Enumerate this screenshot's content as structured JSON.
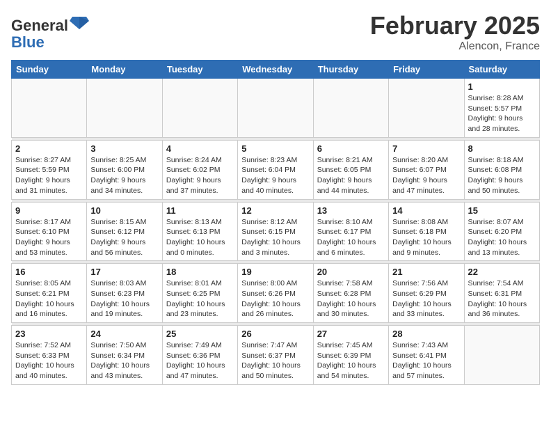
{
  "header": {
    "logo_general": "General",
    "logo_blue": "Blue",
    "month_title": "February 2025",
    "location": "Alencon, France"
  },
  "weekdays": [
    "Sunday",
    "Monday",
    "Tuesday",
    "Wednesday",
    "Thursday",
    "Friday",
    "Saturday"
  ],
  "weeks": [
    [
      {
        "day": "",
        "info": ""
      },
      {
        "day": "",
        "info": ""
      },
      {
        "day": "",
        "info": ""
      },
      {
        "day": "",
        "info": ""
      },
      {
        "day": "",
        "info": ""
      },
      {
        "day": "",
        "info": ""
      },
      {
        "day": "1",
        "info": "Sunrise: 8:28 AM\nSunset: 5:57 PM\nDaylight: 9 hours and 28 minutes."
      }
    ],
    [
      {
        "day": "2",
        "info": "Sunrise: 8:27 AM\nSunset: 5:59 PM\nDaylight: 9 hours and 31 minutes."
      },
      {
        "day": "3",
        "info": "Sunrise: 8:25 AM\nSunset: 6:00 PM\nDaylight: 9 hours and 34 minutes."
      },
      {
        "day": "4",
        "info": "Sunrise: 8:24 AM\nSunset: 6:02 PM\nDaylight: 9 hours and 37 minutes."
      },
      {
        "day": "5",
        "info": "Sunrise: 8:23 AM\nSunset: 6:04 PM\nDaylight: 9 hours and 40 minutes."
      },
      {
        "day": "6",
        "info": "Sunrise: 8:21 AM\nSunset: 6:05 PM\nDaylight: 9 hours and 44 minutes."
      },
      {
        "day": "7",
        "info": "Sunrise: 8:20 AM\nSunset: 6:07 PM\nDaylight: 9 hours and 47 minutes."
      },
      {
        "day": "8",
        "info": "Sunrise: 8:18 AM\nSunset: 6:08 PM\nDaylight: 9 hours and 50 minutes."
      }
    ],
    [
      {
        "day": "9",
        "info": "Sunrise: 8:17 AM\nSunset: 6:10 PM\nDaylight: 9 hours and 53 minutes."
      },
      {
        "day": "10",
        "info": "Sunrise: 8:15 AM\nSunset: 6:12 PM\nDaylight: 9 hours and 56 minutes."
      },
      {
        "day": "11",
        "info": "Sunrise: 8:13 AM\nSunset: 6:13 PM\nDaylight: 10 hours and 0 minutes."
      },
      {
        "day": "12",
        "info": "Sunrise: 8:12 AM\nSunset: 6:15 PM\nDaylight: 10 hours and 3 minutes."
      },
      {
        "day": "13",
        "info": "Sunrise: 8:10 AM\nSunset: 6:17 PM\nDaylight: 10 hours and 6 minutes."
      },
      {
        "day": "14",
        "info": "Sunrise: 8:08 AM\nSunset: 6:18 PM\nDaylight: 10 hours and 9 minutes."
      },
      {
        "day": "15",
        "info": "Sunrise: 8:07 AM\nSunset: 6:20 PM\nDaylight: 10 hours and 13 minutes."
      }
    ],
    [
      {
        "day": "16",
        "info": "Sunrise: 8:05 AM\nSunset: 6:21 PM\nDaylight: 10 hours and 16 minutes."
      },
      {
        "day": "17",
        "info": "Sunrise: 8:03 AM\nSunset: 6:23 PM\nDaylight: 10 hours and 19 minutes."
      },
      {
        "day": "18",
        "info": "Sunrise: 8:01 AM\nSunset: 6:25 PM\nDaylight: 10 hours and 23 minutes."
      },
      {
        "day": "19",
        "info": "Sunrise: 8:00 AM\nSunset: 6:26 PM\nDaylight: 10 hours and 26 minutes."
      },
      {
        "day": "20",
        "info": "Sunrise: 7:58 AM\nSunset: 6:28 PM\nDaylight: 10 hours and 30 minutes."
      },
      {
        "day": "21",
        "info": "Sunrise: 7:56 AM\nSunset: 6:29 PM\nDaylight: 10 hours and 33 minutes."
      },
      {
        "day": "22",
        "info": "Sunrise: 7:54 AM\nSunset: 6:31 PM\nDaylight: 10 hours and 36 minutes."
      }
    ],
    [
      {
        "day": "23",
        "info": "Sunrise: 7:52 AM\nSunset: 6:33 PM\nDaylight: 10 hours and 40 minutes."
      },
      {
        "day": "24",
        "info": "Sunrise: 7:50 AM\nSunset: 6:34 PM\nDaylight: 10 hours and 43 minutes."
      },
      {
        "day": "25",
        "info": "Sunrise: 7:49 AM\nSunset: 6:36 PM\nDaylight: 10 hours and 47 minutes."
      },
      {
        "day": "26",
        "info": "Sunrise: 7:47 AM\nSunset: 6:37 PM\nDaylight: 10 hours and 50 minutes."
      },
      {
        "day": "27",
        "info": "Sunrise: 7:45 AM\nSunset: 6:39 PM\nDaylight: 10 hours and 54 minutes."
      },
      {
        "day": "28",
        "info": "Sunrise: 7:43 AM\nSunset: 6:41 PM\nDaylight: 10 hours and 57 minutes."
      },
      {
        "day": "",
        "info": ""
      }
    ]
  ]
}
